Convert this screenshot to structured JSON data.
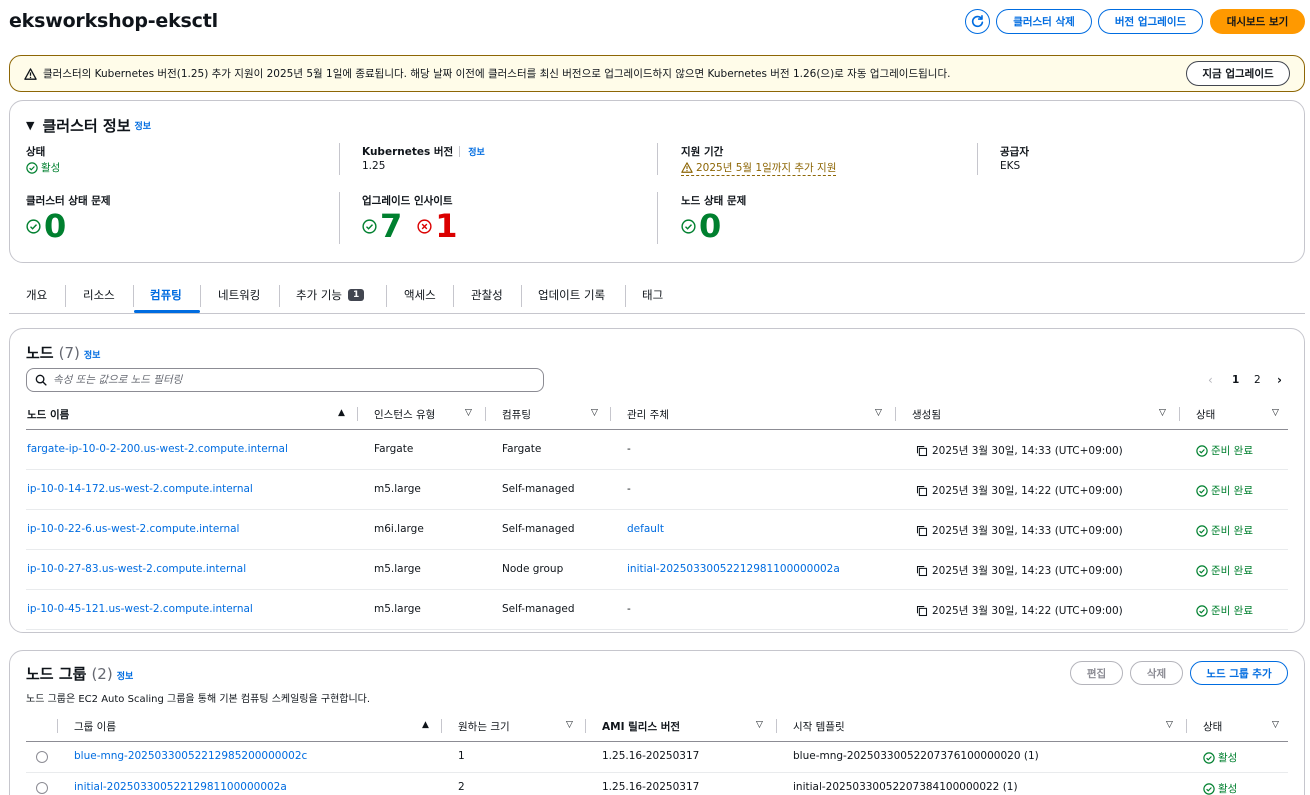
{
  "header": {
    "title": "eksworkshop-eksctl",
    "delete_label": "클러스터 삭제",
    "upgrade_label": "버전 업그레이드",
    "dashboard_label": "대시보드 보기"
  },
  "banner": {
    "text": "클러스터의 Kubernetes 버전(1.25) 추가 지원이 2025년 5월 1일에 종료됩니다. 해당 날짜 이전에 클러스터를 최신 버전으로 업그레이드하지 않으면 Kubernetes 버전 1.26(으)로 자동 업그레이드됩니다.",
    "button_label": "지금 업그레이드"
  },
  "cluster_info": {
    "title": "클러스터 정보",
    "info": "정보",
    "status_label": "상태",
    "status_value": "활성",
    "k8s_label": "Kubernetes 버전",
    "k8s_info": "정보",
    "k8s_value": "1.25",
    "support_label": "지원 기간",
    "support_value": "2025년 5월 1일까지 추가 지원",
    "provider_label": "공급자",
    "provider_value": "EKS",
    "health_label": "클러스터 상태 문제",
    "health_value": "0",
    "insights_label": "업그레이드 인사이트",
    "insights_ok": "7",
    "insights_err": "1",
    "node_health_label": "노드 상태 문제",
    "node_health_value": "0"
  },
  "tabs": [
    {
      "label": "개요"
    },
    {
      "label": "리소스"
    },
    {
      "label": "컴퓨팅"
    },
    {
      "label": "네트워킹"
    },
    {
      "label": "추가 기능",
      "badge": "1"
    },
    {
      "label": "액세스"
    },
    {
      "label": "관찰성"
    },
    {
      "label": "업데이트 기록"
    },
    {
      "label": "태그"
    }
  ],
  "nodes": {
    "title": "노드",
    "count": "(7)",
    "info": "정보",
    "search_placeholder": "속성 또는 값으로 노드 필터링",
    "page1": "1",
    "page2": "2",
    "columns": [
      "노드 이름",
      "인스턴스 유형",
      "컴퓨팅",
      "관리 주체",
      "생성됨",
      "상태"
    ],
    "rows": [
      {
        "name": "fargate-ip-10-0-2-200.us-west-2.compute.internal",
        "type": "Fargate",
        "compute": "Fargate",
        "managed": "-",
        "created": "2025년 3월 30일, 14:33 (UTC+09:00)",
        "status": "준비 완료"
      },
      {
        "name": "ip-10-0-14-172.us-west-2.compute.internal",
        "type": "m5.large",
        "compute": "Self-managed",
        "managed": "-",
        "created": "2025년 3월 30일, 14:22 (UTC+09:00)",
        "status": "준비 완료"
      },
      {
        "name": "ip-10-0-22-6.us-west-2.compute.internal",
        "type": "m6i.large",
        "compute": "Self-managed",
        "managed": "default",
        "created": "2025년 3월 30일, 14:33 (UTC+09:00)",
        "status": "준비 완료"
      },
      {
        "name": "ip-10-0-27-83.us-west-2.compute.internal",
        "type": "m5.large",
        "compute": "Node group",
        "managed": "initial-20250330052212981100000002a",
        "created": "2025년 3월 30일, 14:23 (UTC+09:00)",
        "status": "준비 완료"
      },
      {
        "name": "ip-10-0-45-121.us-west-2.compute.internal",
        "type": "m5.large",
        "compute": "Self-managed",
        "managed": "-",
        "created": "2025년 3월 30일, 14:22 (UTC+09:00)",
        "status": "준비 완료"
      }
    ]
  },
  "node_groups": {
    "title": "노드 그룹",
    "count": "(2)",
    "info": "정보",
    "description": "노드 그룹은 EC2 Auto Scaling 그룹을 통해 기본 컴퓨팅 스케일링을 구현합니다.",
    "edit_label": "편집",
    "delete_label": "삭제",
    "add_label": "노드 그룹 추가",
    "columns": [
      "그룹 이름",
      "원하는 크기",
      "AMI 릴리스 버전",
      "시작 템플릿",
      "상태"
    ],
    "rows": [
      {
        "name": "blue-mng-20250330052212985200000002c",
        "size": "1",
        "ami": "1.25.16-20250317",
        "template": "blue-mng-20250330052207376100000020 (1)",
        "status": "활성"
      },
      {
        "name": "initial-20250330052212981100000002a",
        "size": "2",
        "ami": "1.25.16-20250317",
        "template": "initial-20250330052207384100000022 (1)",
        "status": "활성"
      }
    ]
  }
}
